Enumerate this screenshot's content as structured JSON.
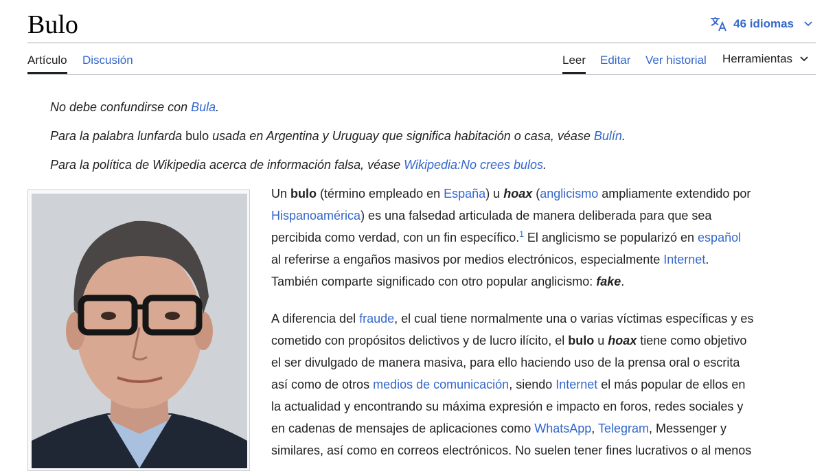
{
  "header": {
    "title": "Bulo",
    "languages_label": "46 idiomas",
    "translate_icon": "translate-icon"
  },
  "tabs": {
    "article": "Artículo",
    "discussion": "Discusión",
    "read": "Leer",
    "edit": "Editar",
    "history": "Ver historial",
    "tools": "Herramientas"
  },
  "hatnotes": [
    {
      "pre": "No debe confundirse con ",
      "link": "Bula",
      "post": "."
    },
    {
      "pre": "Para la palabra lunfarda ",
      "plain": "bulo",
      "mid": " usada en Argentina y Uruguay que significa habitación o casa, véase ",
      "link": "Bulín",
      "post": "."
    },
    {
      "pre": "Para la política de Wikipedia acerca de información falsa, véase ",
      "link": "Wikipedia:No crees bulos",
      "post": "."
    }
  ],
  "para1": {
    "l1": {
      "a": "Un ",
      "b": "bulo",
      "c": " (término empleado en ",
      "d": "España",
      "e": ") u ",
      "f": "hoax",
      "g": " (",
      "h": "anglicismo",
      "i": " ampliamente extendido por"
    },
    "l2": {
      "a": "Hispanoamérica",
      "b": ") es una falsedad articulada de manera deliberada para que sea"
    },
    "l3": {
      "a": "percibida como verdad, con un fin específico.",
      "ref": "1",
      "b": "  El anglicismo se popularizó en ",
      "c": "español"
    },
    "l4": {
      "a": "al referirse a engaños masivos por medios electrónicos, especialmente ",
      "b": "Internet",
      "c": "."
    },
    "l5": {
      "a": "También comparte significado con otro popular anglicismo: ",
      "b": "fake",
      "c": "."
    }
  },
  "para2": {
    "l1": {
      "a": "A diferencia del ",
      "b": "fraude",
      "c": ", el cual tiene normalmente una o varias víctimas específicas y es"
    },
    "l2": {
      "a": "cometido con propósitos delictivos y de lucro ilícito, el ",
      "b": "bulo",
      "c": " u ",
      "d": "hoax",
      "e": " tiene como objetivo"
    },
    "l3": {
      "a": "el ser divulgado de manera masiva, para ello haciendo uso de la prensa oral o escrita"
    },
    "l4": {
      "a": "así como de otros ",
      "b": "medios de comunicación",
      "c": ", siendo ",
      "d": "Internet",
      "e": " el más popular de ellos en"
    },
    "l5": {
      "a": "la actualidad y encontrando su máxima expresión e impacto en foros, redes sociales y"
    },
    "l6": {
      "a": "en cadenas de mensajes de aplicaciones como ",
      "b": "WhatsApp",
      "c": ", ",
      "d": "Telegram",
      "e": ", Messenger y"
    },
    "l7": {
      "a": "similares, así como en correos electrónicos. No suelen tener fines lucrativos o al menos"
    }
  },
  "colors": {
    "link": "#3366cc",
    "text": "#202122",
    "border": "#a2a9b1"
  }
}
